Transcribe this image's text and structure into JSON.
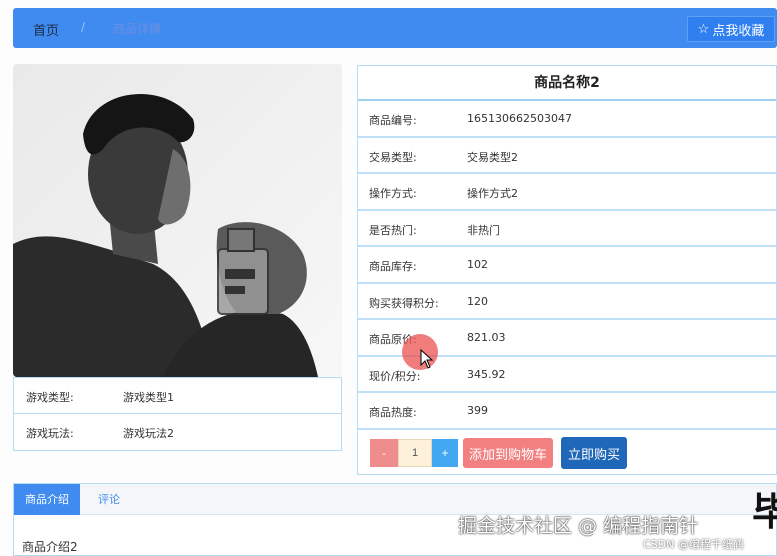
{
  "nav": {
    "home_label": "首页",
    "separator": "/",
    "current_label": "商品详情",
    "favorite_label": "点我收藏",
    "favorite_icon": "star-outline-icon"
  },
  "left_info": [
    {
      "label": "游戏类型:",
      "value": "游戏类型1"
    },
    {
      "label": "游戏玩法:",
      "value": "游戏玩法2"
    }
  ],
  "product": {
    "title": "商品名称2",
    "fields": [
      {
        "label": "商品编号:",
        "value": "165130662503047"
      },
      {
        "label": "交易类型:",
        "value": "交易类型2"
      },
      {
        "label": "操作方式:",
        "value": "操作方式2"
      },
      {
        "label": "是否热门:",
        "value": "非热门"
      },
      {
        "label": "商品库存:",
        "value": "102"
      },
      {
        "label": "购买获得积分:",
        "value": "120"
      },
      {
        "label": "商品原价:",
        "value": "821.03"
      },
      {
        "label": "现价/积分:",
        "value": "345.92"
      },
      {
        "label": "商品热度:",
        "value": "399"
      }
    ]
  },
  "actions": {
    "minus_label": "-",
    "quantity": "1",
    "plus_label": "+",
    "add_to_cart": "添加到购物车",
    "buy_now": "立即购买"
  },
  "tabs": {
    "intro_label": "商品介绍",
    "comment_label": "评论",
    "intro_content": "商品介绍2"
  },
  "watermark": {
    "main": "掘金技术社区 @ 编程指南针",
    "sub": "CSDN @编程千纸鹤",
    "edge_glyph": "毕"
  },
  "colors": {
    "primary": "#3f8bf0",
    "add_cart": "#f28080",
    "buy_now": "#1f67b8",
    "border": "#b6dcf4"
  }
}
